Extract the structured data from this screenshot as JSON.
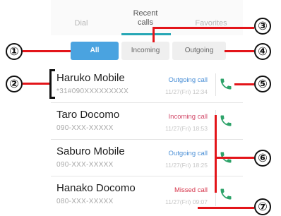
{
  "tabs": {
    "dial": "Dial",
    "recent": "Recent calls",
    "favorites": "Favorites"
  },
  "filters": {
    "all": "All",
    "incoming": "Incoming",
    "outgoing": "Outgoing"
  },
  "calls": [
    {
      "name": "Haruko Mobile",
      "number": "*31#090XXXXXXXXX",
      "type": "Outgoing call",
      "date": "11/27(Fri) 12:34"
    },
    {
      "name": "Taro Docomo",
      "number": "090-XXX-XXXXX",
      "type": "Incoming call",
      "date": "11/27(Fri) 18:53"
    },
    {
      "name": "Saburo Mobile",
      "number": "090-XXX-XXXXX",
      "type": "Outgoing call",
      "date": "11/27(Fri) 18:25"
    },
    {
      "name": "Hanako Docomo",
      "number": "080-XXX-XXXXX",
      "type": "Missed call",
      "date": "11/27(Fri) 09:07"
    }
  ],
  "callouts": [
    "①",
    "②",
    "③",
    "④",
    "⑤",
    "⑥",
    "⑦"
  ],
  "colors": {
    "accent": "#4aa3e0",
    "outgoing": "#4a8fd6",
    "incoming": "#d24a6a",
    "missed": "#d6344a",
    "phone_icon": "#2ea36a",
    "callout_line": "#e3151a"
  },
  "icons": {
    "call": "phone-icon"
  }
}
